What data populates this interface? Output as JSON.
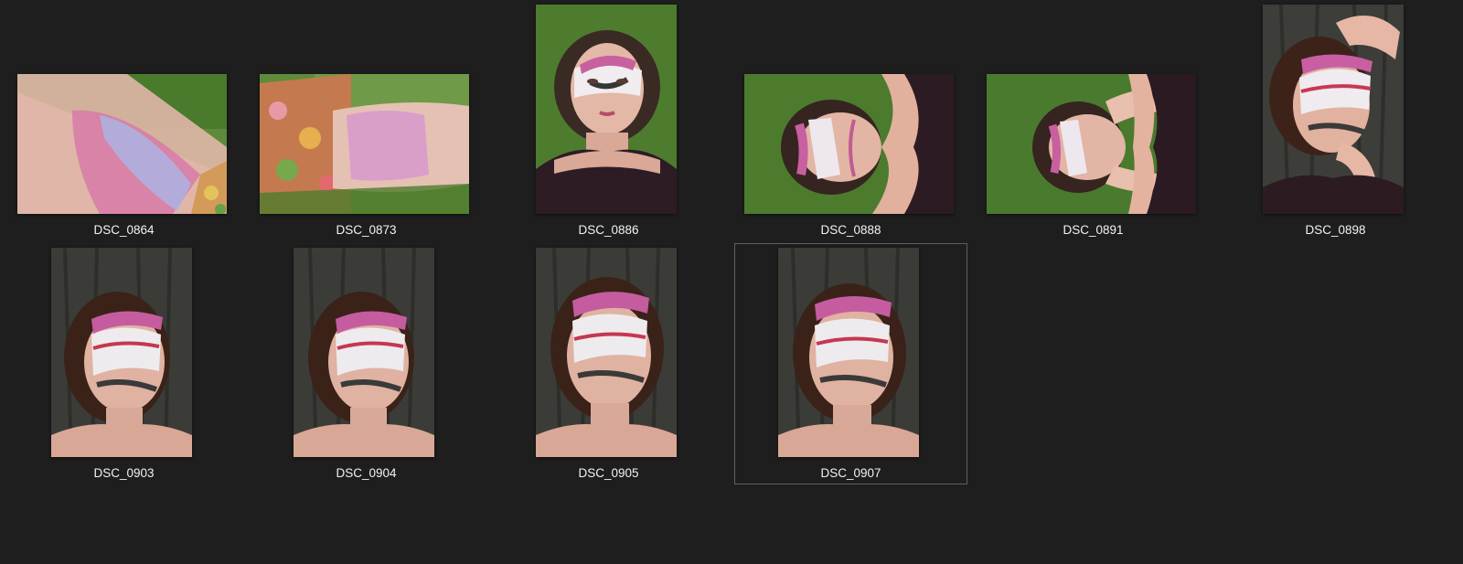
{
  "window": {
    "background": "#1e1e1e",
    "label_color": "#f2f2f2",
    "selection_border": "#5f5f5f"
  },
  "files": [
    {
      "name": "DSC_0864",
      "orientation": "landscape",
      "scene": "arm-grass",
      "selected": false
    },
    {
      "name": "DSC_0873",
      "orientation": "landscape",
      "scene": "leg-grass",
      "selected": false
    },
    {
      "name": "DSC_0886",
      "orientation": "portrait",
      "scene": "face-grass-top",
      "selected": false
    },
    {
      "name": "DSC_0888",
      "orientation": "landscape",
      "scene": "face-grass-rotated",
      "selected": false
    },
    {
      "name": "DSC_0891",
      "orientation": "landscape",
      "scene": "face-grass-hands",
      "selected": false
    },
    {
      "name": "DSC_0898",
      "orientation": "portrait",
      "scene": "face-bark-hand",
      "selected": false
    },
    {
      "name": "DSC_0903",
      "orientation": "portrait",
      "scene": "face-bark",
      "selected": false
    },
    {
      "name": "DSC_0904",
      "orientation": "portrait",
      "scene": "face-bark",
      "selected": false
    },
    {
      "name": "DSC_0905",
      "orientation": "portrait",
      "scene": "face-bark",
      "selected": false
    },
    {
      "name": "DSC_0907",
      "orientation": "portrait",
      "scene": "face-bark",
      "selected": true
    }
  ]
}
